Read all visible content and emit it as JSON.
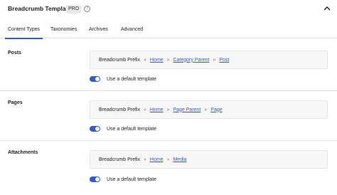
{
  "header": {
    "title": "Breadcrumb Templates",
    "badge": "PRO",
    "help_icon": "help-circle-icon",
    "collapse_icon": "chevron-up-icon"
  },
  "tabs": [
    {
      "label": "Content Types",
      "active": true
    },
    {
      "label": "Taxonomies",
      "active": false
    },
    {
      "label": "Archives",
      "active": false
    },
    {
      "label": "Advanced",
      "active": false
    }
  ],
  "sections": [
    {
      "label": "Posts",
      "prefix": "Breadcrumb Prefix",
      "separator": "»",
      "links": [
        "Home",
        "Category Parent",
        "Post"
      ],
      "toggle_label": "Use a default template",
      "toggle_on": true
    },
    {
      "label": "Pages",
      "prefix": "Breadcrumb Prefix",
      "separator": "»",
      "links": [
        "Home",
        "Page Parent",
        "Page"
      ],
      "toggle_label": "Use a default template",
      "toggle_on": true
    },
    {
      "label": "Attachments",
      "prefix": "Breadcrumb Prefix",
      "separator": "»",
      "links": [
        "Home",
        "Media"
      ],
      "toggle_label": "Use a default template",
      "toggle_on": true
    }
  ],
  "colors": {
    "accent": "#3858e9",
    "link": "#2f5dd8",
    "toggle": "#2f5dd8"
  }
}
